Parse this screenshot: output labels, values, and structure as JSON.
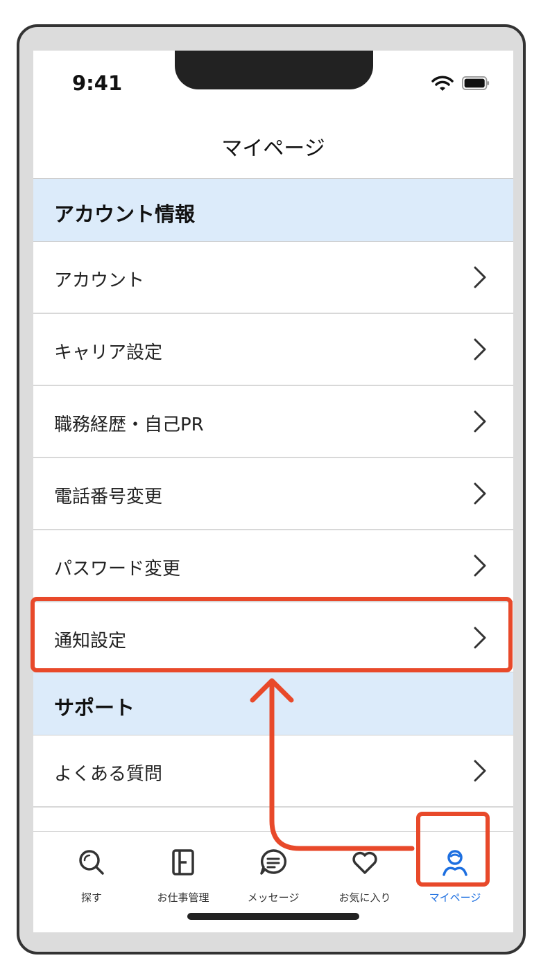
{
  "status_bar": {
    "time": "9:41",
    "wifi_icon": "wifi-icon",
    "battery_icon": "battery-icon"
  },
  "header": {
    "title": "マイページ"
  },
  "sections": [
    {
      "title": "アカウント情報",
      "items": [
        {
          "label": "アカウント"
        },
        {
          "label": "キャリア設定"
        },
        {
          "label": "職務経歴・自己PR"
        },
        {
          "label": "電話番号変更"
        },
        {
          "label": "パスワード変更"
        },
        {
          "label": "通知設定"
        }
      ]
    },
    {
      "title": "サポート",
      "items": [
        {
          "label": "よくある質問"
        }
      ]
    }
  ],
  "tabbar": {
    "tabs": [
      {
        "label": "探す",
        "icon": "search-icon"
      },
      {
        "label": "お仕事管理",
        "icon": "job-manage-icon"
      },
      {
        "label": "メッセージ",
        "icon": "message-icon"
      },
      {
        "label": "お気に入り",
        "icon": "heart-icon"
      },
      {
        "label": "マイページ",
        "icon": "person-icon",
        "active": true
      }
    ]
  },
  "annotation": {
    "highlight_color": "#e8492a",
    "highlighted_item": "通知設定",
    "highlighted_tab": "マイページ"
  },
  "colors": {
    "section_bg": "#dcebfa",
    "active_tab": "#1d6fe0"
  }
}
